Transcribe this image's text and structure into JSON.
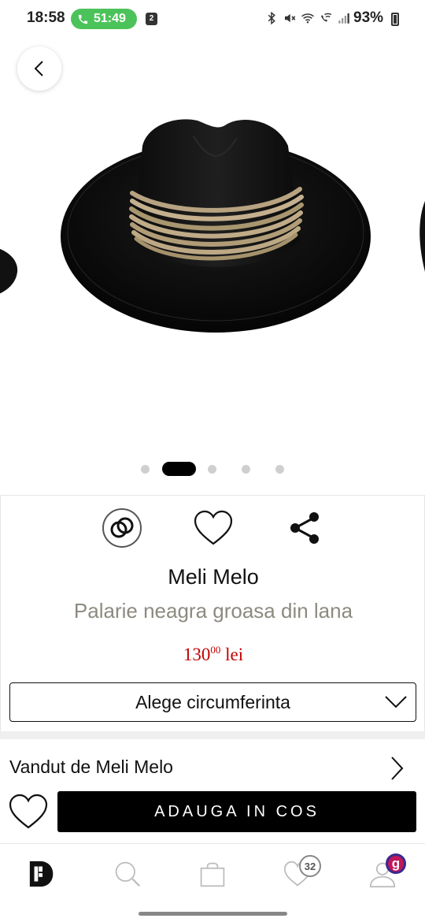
{
  "status_bar": {
    "time": "18:58",
    "call_timer": "51:49",
    "notification_count": "2",
    "battery": "93%",
    "icons": [
      "bluetooth-icon",
      "mute-icon",
      "wifi-icon",
      "wifi-call-icon",
      "signal-icon",
      "battery-icon"
    ],
    "call_color": "#4cc35a"
  },
  "gallery": {
    "image": "black-wool-fedora-hat-with-twine-band",
    "dot_count": 5,
    "active_dot": 1
  },
  "product": {
    "actions": [
      "compare-icon",
      "heart-icon",
      "share-icon"
    ],
    "brand": "Meli Melo",
    "title": "Palarie neagra groasa din lana",
    "price_main": "130",
    "price_decimals": "00",
    "price_currency": "lei",
    "price_color": "#c40000",
    "title_color": "#8d8a80"
  },
  "size_select": {
    "label": "Alege circumferinta"
  },
  "seller": {
    "label": "Vandut de Meli Melo"
  },
  "buy": {
    "add_to_cart_label": "ADAUGA IN COS"
  },
  "bottom_nav": {
    "items": [
      "home-logo-icon",
      "search-icon",
      "bag-icon",
      "favorites-icon",
      "account-icon"
    ],
    "favorites_badge": "32",
    "account_badge": "g"
  }
}
